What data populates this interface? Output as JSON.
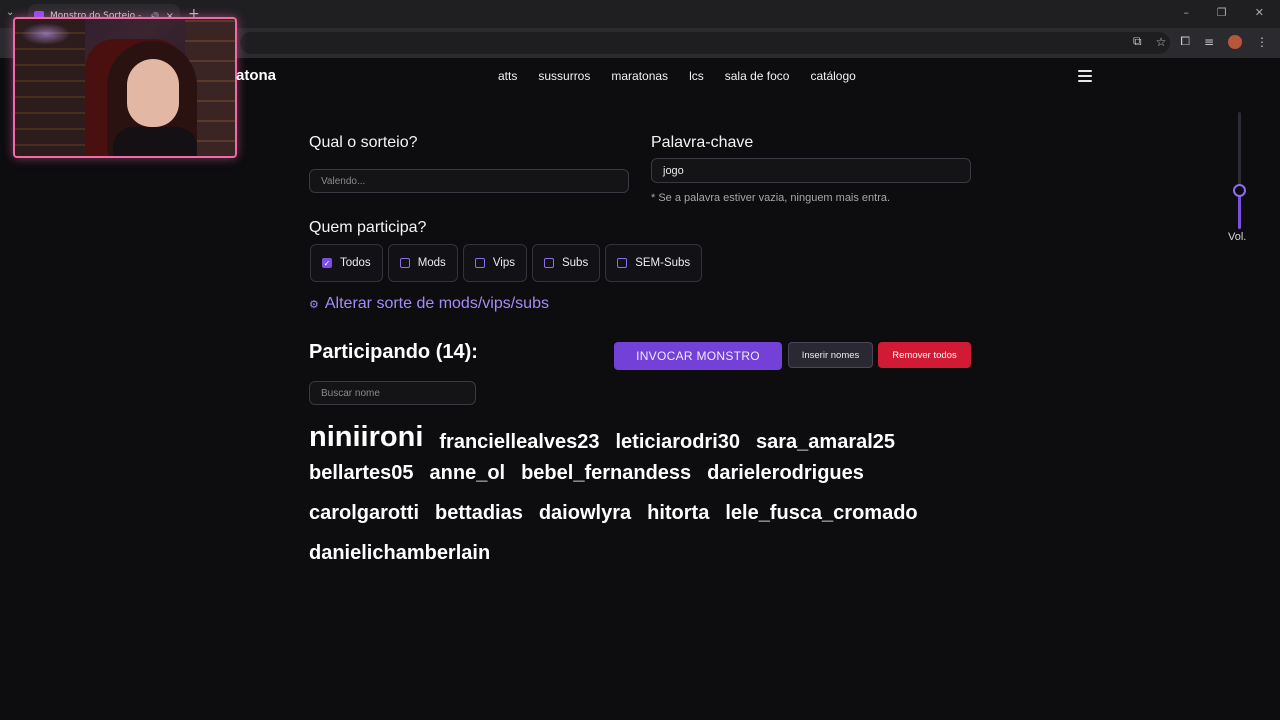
{
  "browser": {
    "tab_title": "Monstro do Sorteio - Twitch",
    "new_tab": "+",
    "close_tab": "×"
  },
  "site": {
    "brand": "atona",
    "nav": [
      "atts",
      "sussurros",
      "maratonas",
      "lcs",
      "sala de foco",
      "catálogo"
    ]
  },
  "form": {
    "draw_label": "Qual o sorteio?",
    "draw_placeholder": "Valendo...",
    "keyword_label": "Palavra-chave",
    "keyword_value": "jogo",
    "keyword_hint": "* Se a palavra estiver vazia, ninguem mais entra.",
    "who_label": "Quem participa?",
    "options": [
      {
        "label": "Todos",
        "checked": true
      },
      {
        "label": "Mods",
        "checked": false
      },
      {
        "label": "Vips",
        "checked": false
      },
      {
        "label": "Subs",
        "checked": false
      },
      {
        "label": "SEM-Subs",
        "checked": false
      }
    ],
    "luck_link": "Alterar sorte de mods/vips/subs"
  },
  "participants": {
    "heading": "Participando (14):",
    "invoke_button": "INVOCAR MONSTRO",
    "insert_button": "Inserir nomes",
    "remove_button": "Remover todos",
    "search_placeholder": "Buscar nome",
    "rows": [
      [
        "niniironi",
        "franciellealves23",
        "leticiarodri30",
        "sara_amaral25"
      ],
      [
        "bellartes05",
        "anne_ol",
        "bebel_fernandess",
        "darielerodrigues"
      ],
      [
        "carolgarotti",
        "bettadias",
        "daiowlyra",
        "hitorta",
        "lele_fusca_cromado"
      ],
      [
        "danielichamberlain"
      ]
    ]
  },
  "volume": {
    "label": "Vol.",
    "level": 0.33
  },
  "colors": {
    "accent": "#7340d8",
    "danger": "#d11a34",
    "background": "#0d0c0f"
  }
}
